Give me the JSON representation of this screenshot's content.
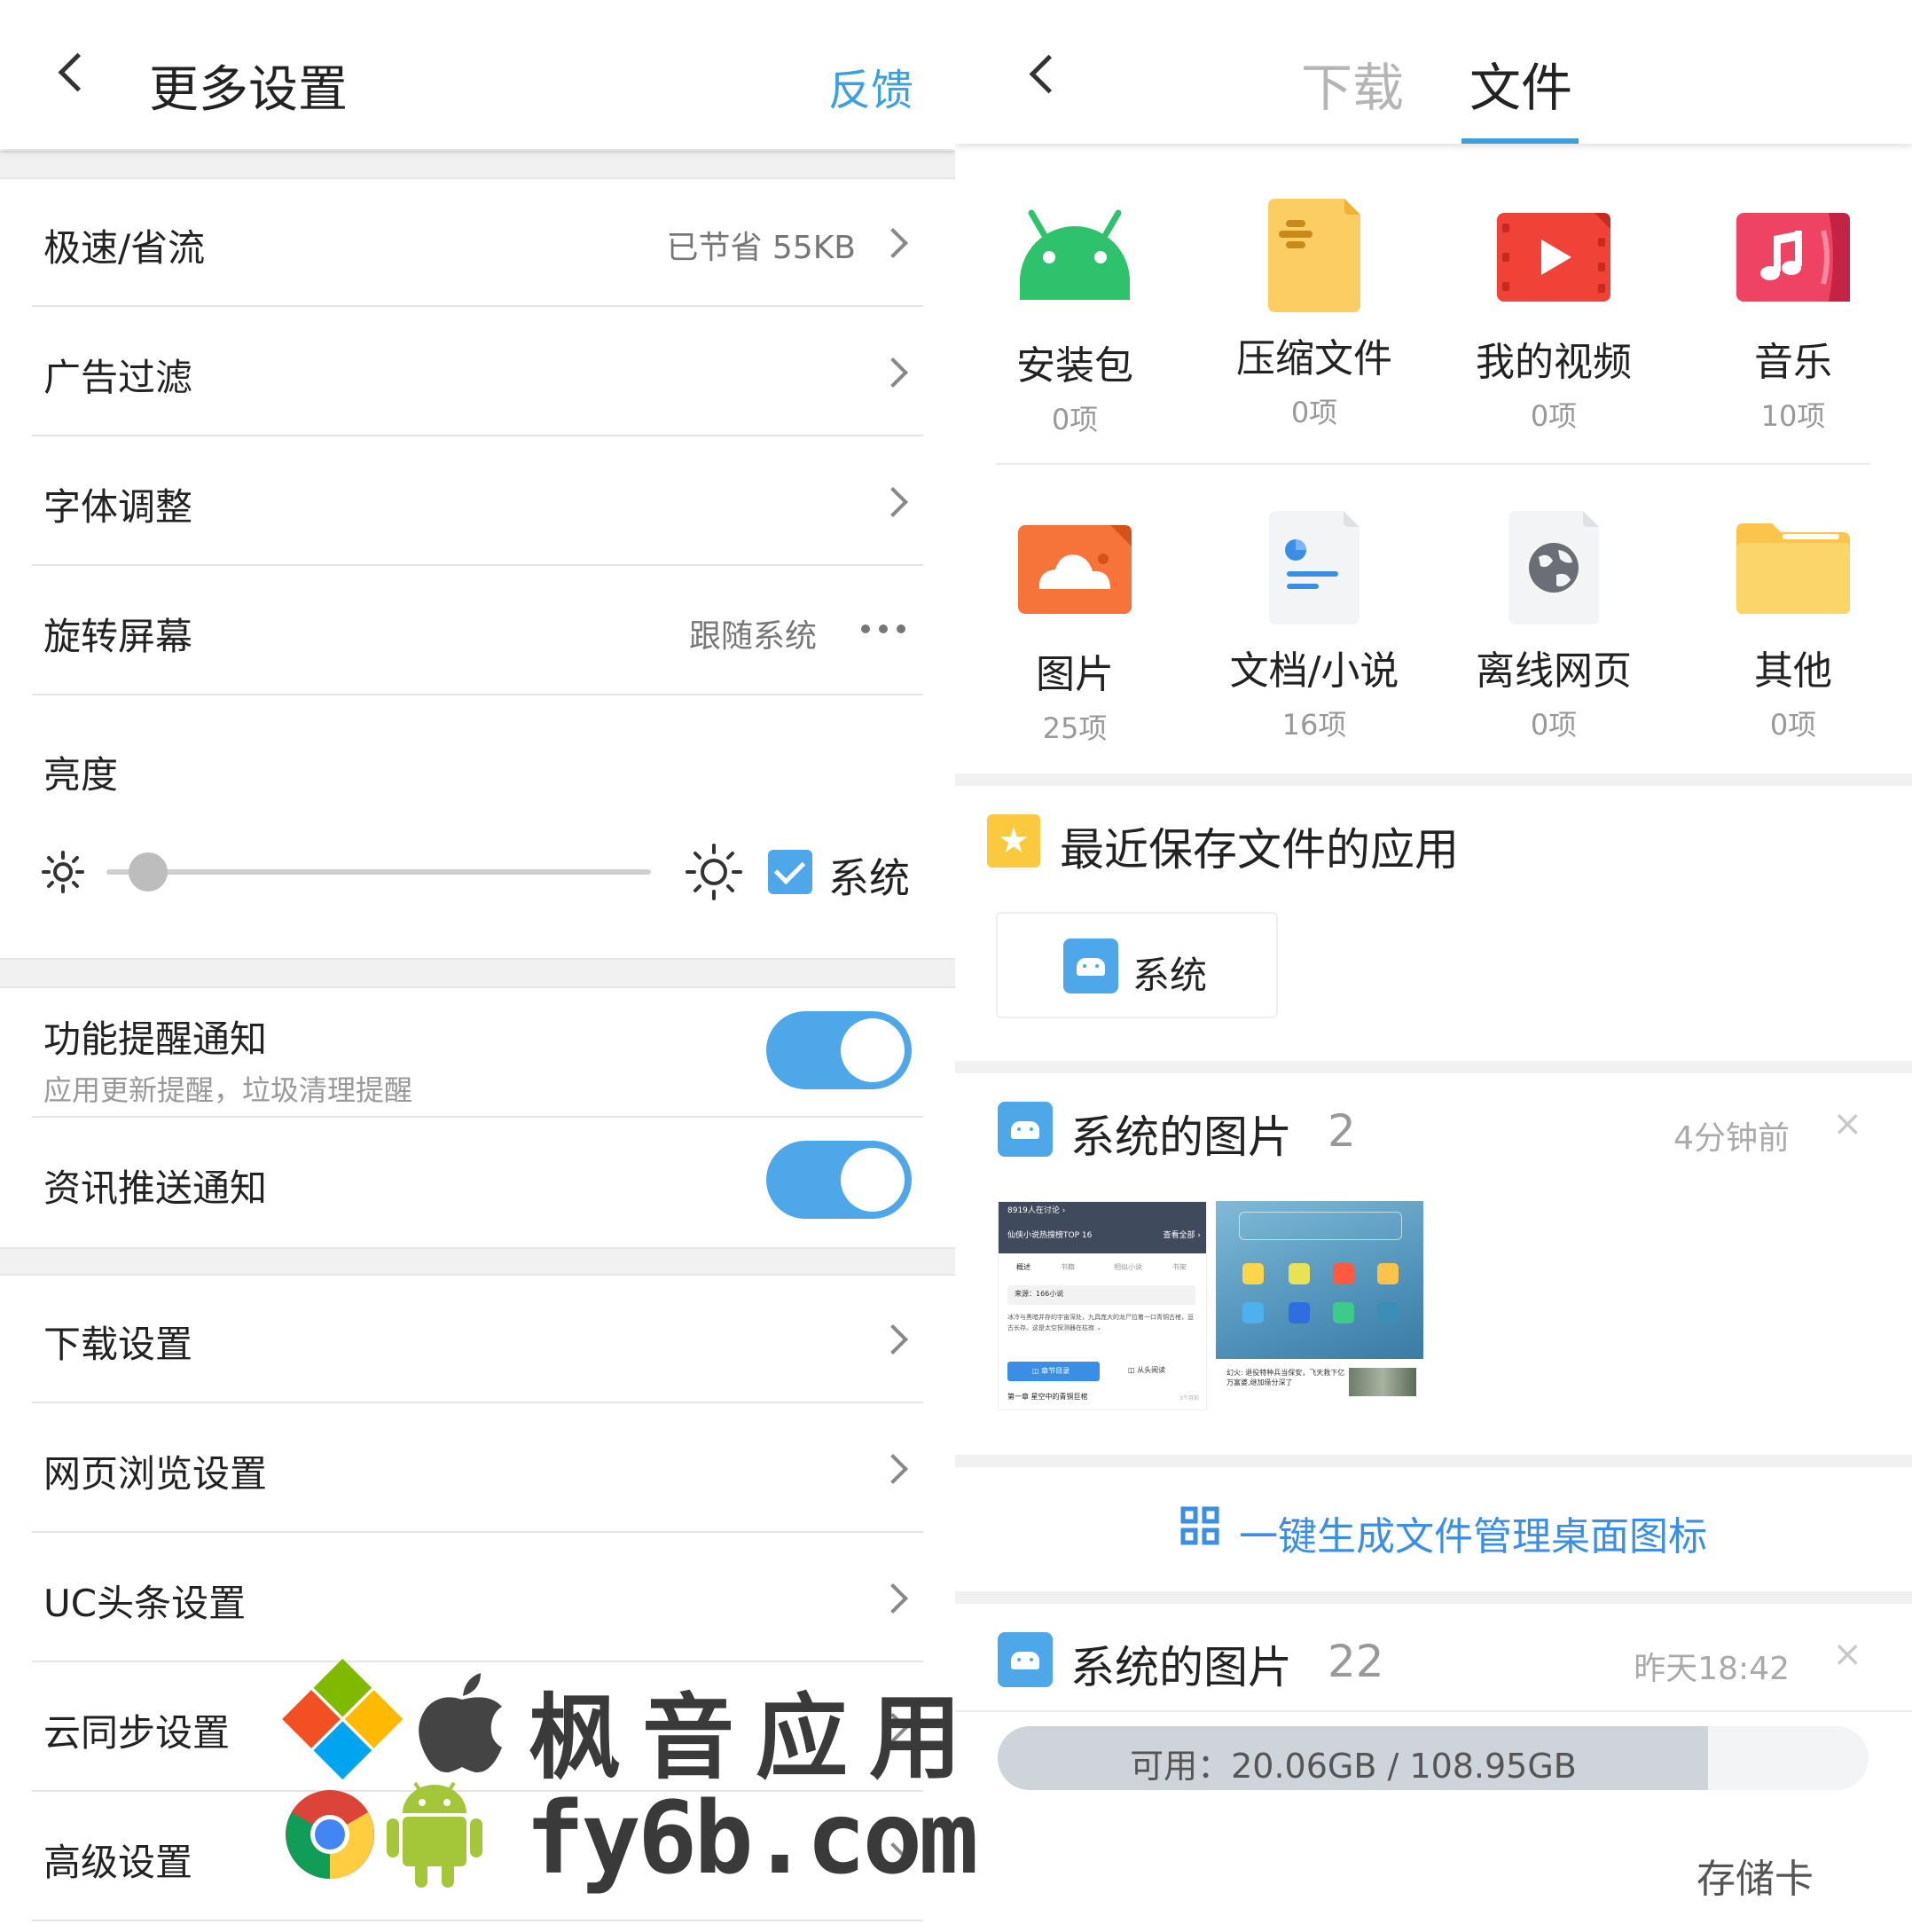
{
  "left": {
    "header": {
      "title": "更多设置",
      "feedback": "反馈"
    },
    "rows": {
      "speed": {
        "label": "极速/省流",
        "value": "已节省 55KB"
      },
      "adblock": {
        "label": "广告过滤"
      },
      "font": {
        "label": "字体调整"
      },
      "rotate": {
        "label": "旋转屏幕",
        "value": "跟随系统"
      },
      "brightness": {
        "label": "亮度",
        "system_label": "系统",
        "system_checked": true,
        "level": 0.04
      },
      "notify_feature": {
        "label": "功能提醒通知",
        "sub": "应用更新提醒，垃圾清理提醒",
        "on": true
      },
      "notify_news": {
        "label": "资讯推送通知",
        "on": true
      },
      "download": {
        "label": "下载设置"
      },
      "browse": {
        "label": "网页浏览设置"
      },
      "uc": {
        "label": "UC头条设置"
      },
      "cloud": {
        "label": "云同步设置"
      },
      "advanced": {
        "label": "高级设置"
      }
    }
  },
  "right": {
    "tabs": {
      "download": "下载",
      "files": "文件",
      "active": "files"
    },
    "categories": [
      {
        "name": "安装包",
        "count": "0项",
        "icon": "android-apk-icon"
      },
      {
        "name": "压缩文件",
        "count": "0项",
        "icon": "zip-file-icon"
      },
      {
        "name": "我的视频",
        "count": "0项",
        "icon": "video-icon"
      },
      {
        "name": "音乐",
        "count": "10项",
        "icon": "music-icon"
      },
      {
        "name": "图片",
        "count": "25项",
        "icon": "image-icon"
      },
      {
        "name": "文档/小说",
        "count": "16项",
        "icon": "document-icon"
      },
      {
        "name": "离线网页",
        "count": "0项",
        "icon": "globe-icon"
      },
      {
        "name": "其他",
        "count": "0项",
        "icon": "folder-icon"
      }
    ],
    "recent_apps": {
      "title": "最近保存文件的应用",
      "app": "系统"
    },
    "group1": {
      "title": "系统的图片",
      "count": "2",
      "time": "4分钟前"
    },
    "group1_thumb1": {
      "banner": "8919人在讨论 ›",
      "head": "仙侠小说热搜榜TOP 16",
      "more": "查看全部 ›",
      "tabs": [
        "概述",
        "书籍",
        "相似小说",
        "书架"
      ],
      "source": "来源：166小说",
      "body": "冰冷与黑暗并存的宇宙深处，九具庞大的龙尸拉着一口青铜古棺，亘古长存。这是太空探测器在枯寂 ⌄",
      "btn1": "◫ 章节目录",
      "btn2": "◫ 从头阅读",
      "chapter": "第一章 星空中的青铜巨棺",
      "chapter_time": "3个月前"
    },
    "group1_thumb2": {
      "caption": "幻火: 退役特种兵当保安，飞天救下亿万富婆,继加缘分深了"
    },
    "shortcut": "一键生成文件管理桌面图标",
    "group2": {
      "title": "系统的图片",
      "count": "22",
      "time": "昨天18:42"
    },
    "storage": {
      "text": "可用：20.06GB / 108.95GB",
      "used_fraction": 0.816,
      "card": "存储卡"
    }
  },
  "watermark": {
    "cn": "枫音应用",
    "url": "fy6b.com"
  },
  "colors": {
    "accent": "#3aa0e0",
    "toggle": "#4ea7e8",
    "gray_text": "#999999"
  }
}
